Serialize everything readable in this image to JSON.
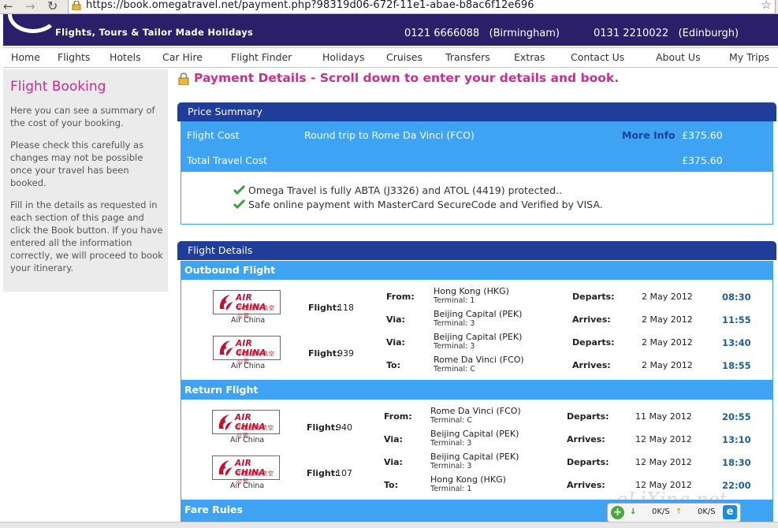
{
  "browser": {
    "url": "https://book.omegatravel.net/payment.php?98319d06-672f-11e1-abae-b8ac6f12e696"
  },
  "header": {
    "tagline": "Flights, Tours & Tailor Made Holidays",
    "phones": [
      {
        "number": "0121 6666088",
        "city": "(Birmingham)"
      },
      {
        "number": "0131 2210022",
        "city": "(Edinburgh)"
      }
    ]
  },
  "nav": [
    "Home",
    "Flights",
    "Hotels",
    "Car Hire",
    "Flight Finder",
    "Holidays",
    "Cruises",
    "Transfers",
    "Extras",
    "Contact Us",
    "About Us",
    "My Trips"
  ],
  "sidebar": {
    "title": "Flight Booking",
    "p1": "Here you can see a summary of the cost of your booking.",
    "p2": "Please check this carefully as changes may not be possible once your travel has been booked.",
    "p3": "Fill in the details as requested in each section of this page and click the Book button. If you have entered all the information correctly, we will proceed to book your itinerary."
  },
  "heading": "Payment Details - Scroll down to enter your details and book.",
  "price_summary": {
    "title": "Price Summary",
    "flight_cost_label": "Flight Cost",
    "flight_desc": "Round trip to Rome Da Vinci (FCO)",
    "more_info": "More Info",
    "flight_cost": "£375.60",
    "total_label": "Total Travel Cost",
    "total": "£375.60",
    "notes": [
      "Omega Travel is fully ABTA (J3326) and ATOL (4419) protected..",
      "Safe online payment with MasterCard SecureCode and Verified by VISA."
    ]
  },
  "flight_details": {
    "title": "Flight Details",
    "outbound_title": "Outbound Flight",
    "return_title": "Return Flight",
    "fare_rules": "Fare Rules",
    "airline_en": "AIR CHINA",
    "airline_cn": "中国国际航空公司",
    "airline_name": "Air China",
    "flight_label": "Flight:",
    "outbound": [
      {
        "flight": "118",
        "a": {
          "label": "From:",
          "place": "Hong Kong (HKG)",
          "terminal": "Terminal: 1",
          "tlabel": "Departs:",
          "date": "2 May 2012",
          "time": "08:30"
        },
        "b": {
          "label": "Via:",
          "place": "Beijing Capital (PEK)",
          "terminal": "Terminal: 3",
          "tlabel": "Arrives:",
          "date": "2 May 2012",
          "time": "11:55"
        }
      },
      {
        "flight": "939",
        "a": {
          "label": "Via:",
          "place": "Beijing Capital (PEK)",
          "terminal": "Terminal: 3",
          "tlabel": "Departs:",
          "date": "2 May 2012",
          "time": "13:40"
        },
        "b": {
          "label": "To:",
          "place": "Rome Da Vinci (FCO)",
          "terminal": "Terminal: C",
          "tlabel": "Arrives:",
          "date": "2 May 2012",
          "time": "18:55"
        }
      }
    ],
    "return": [
      {
        "flight": "940",
        "a": {
          "label": "From:",
          "place": "Rome Da Vinci (FCO)",
          "terminal": "Terminal: C",
          "tlabel": "Departs:",
          "date": "11 May 2012",
          "time": "20:55"
        },
        "b": {
          "label": "Via:",
          "place": "Beijing Capital (PEK)",
          "terminal": "Terminal: 3",
          "tlabel": "Arrives:",
          "date": "12 May 2012",
          "time": "13:10"
        }
      },
      {
        "flight": "107",
        "a": {
          "label": "Via:",
          "place": "Beijing Capital (PEK)",
          "terminal": "Terminal: 3",
          "tlabel": "Departs:",
          "date": "12 May 2012",
          "time": "18:30"
        },
        "b": {
          "label": "To:",
          "place": "Hong Kong (HKG)",
          "terminal": "Terminal: 1",
          "tlabel": "Arrives:",
          "date": "12 May 2012",
          "time": "22:00"
        }
      }
    ]
  },
  "download_widget": {
    "down": "0K/S",
    "up": "0K/S"
  },
  "watermark": "eLiXing.net"
}
